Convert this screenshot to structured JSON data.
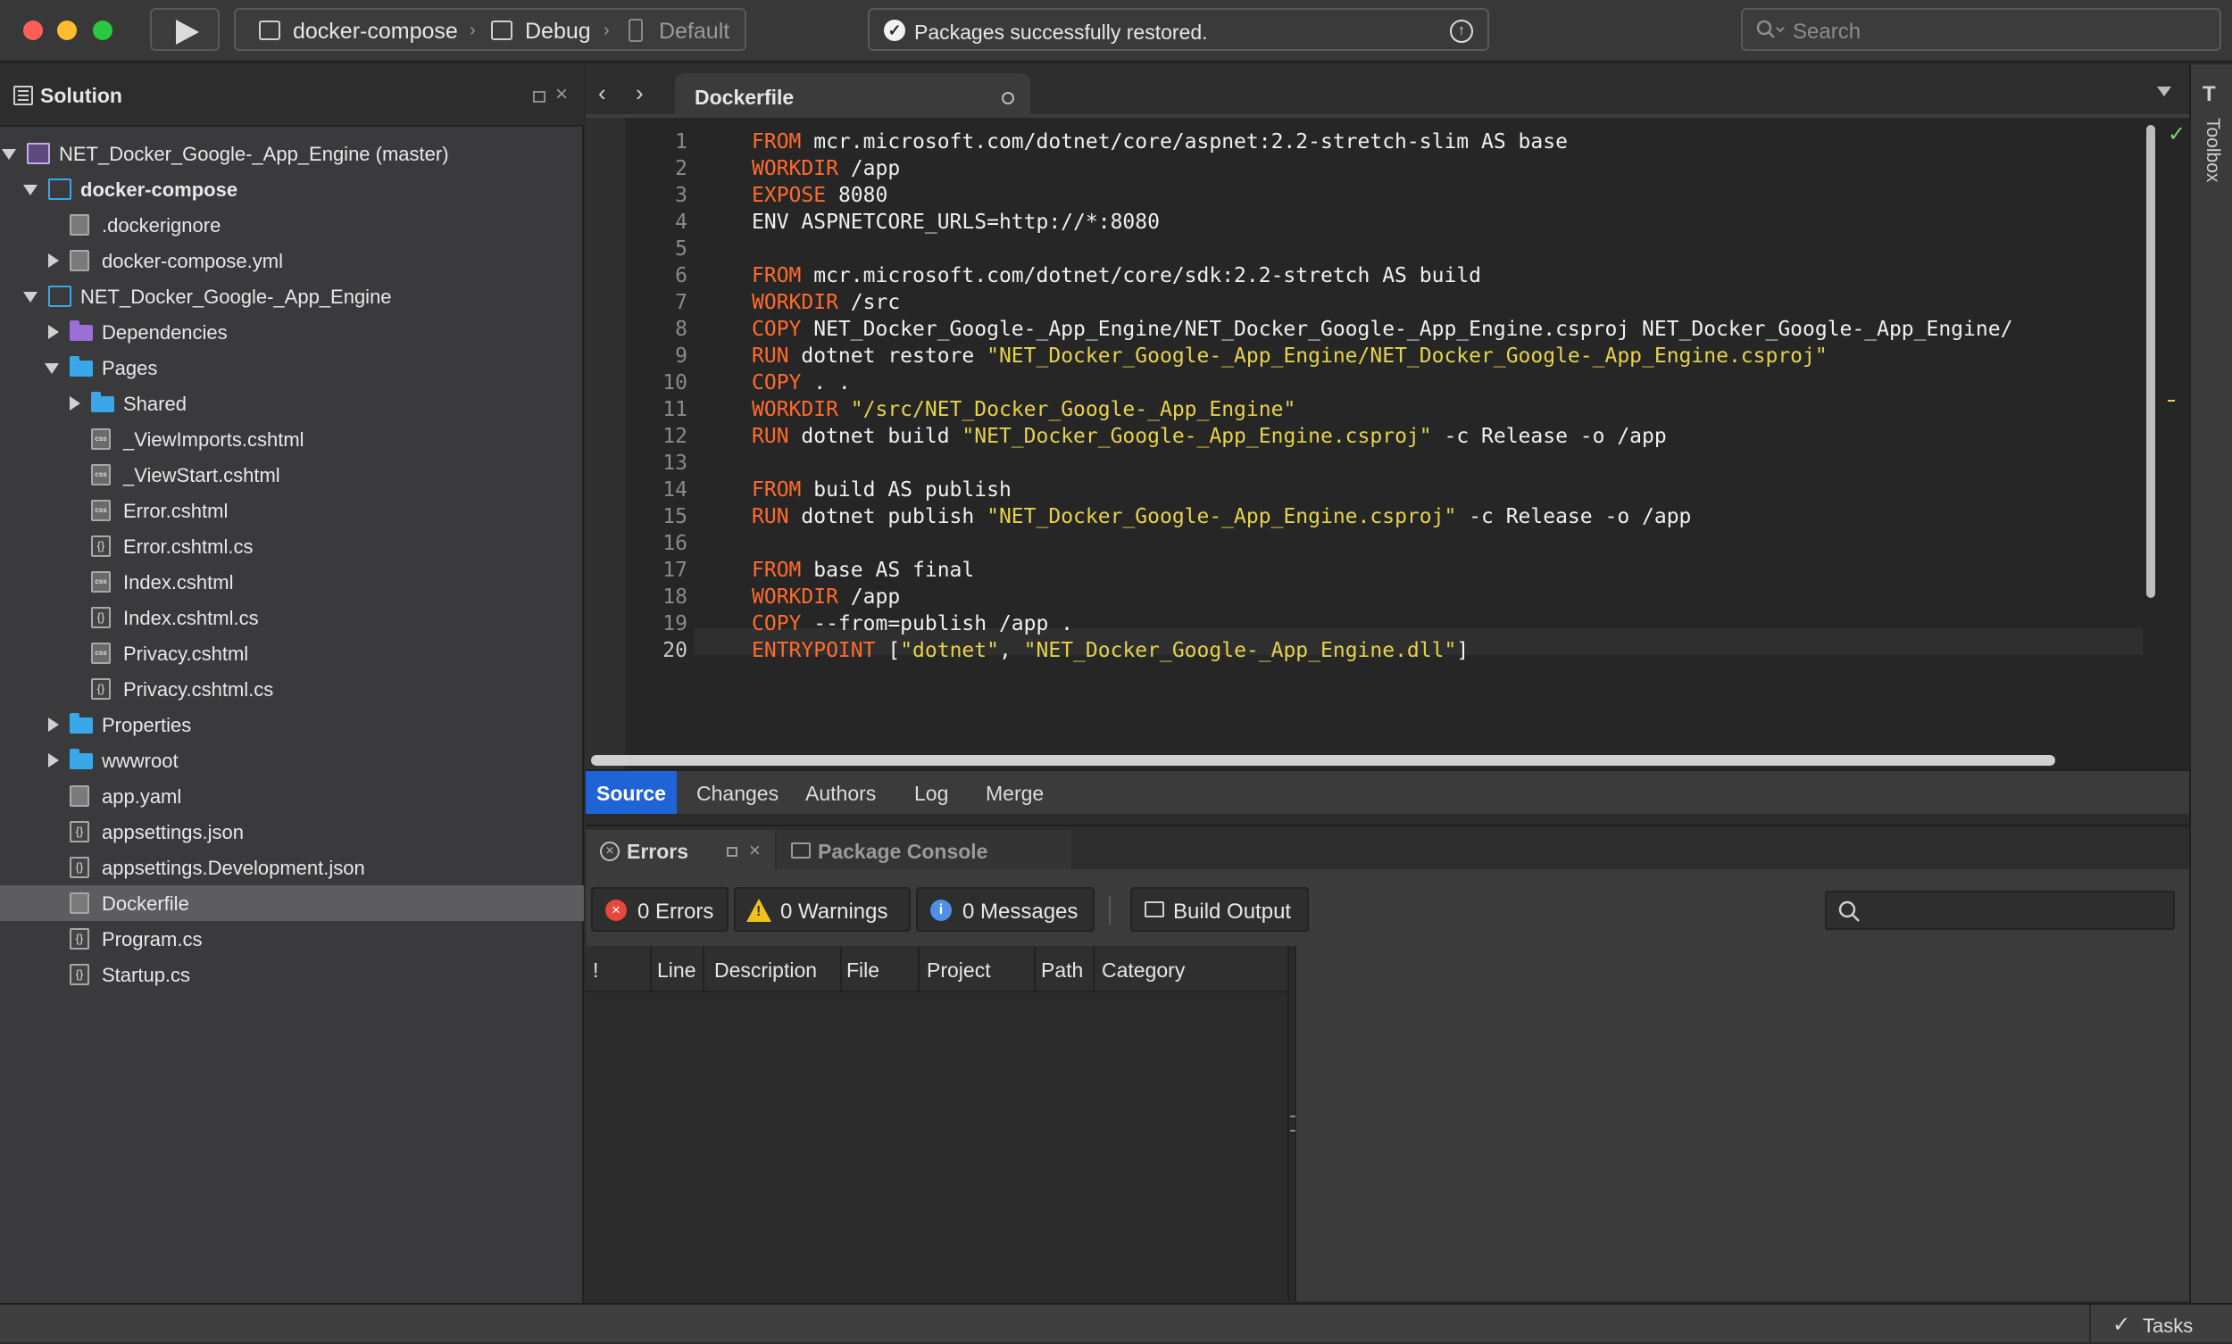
{
  "toolbar": {
    "config_project": "docker-compose",
    "config_mode": "Debug",
    "config_target": "Default",
    "status_text": "Packages successfully restored.",
    "search_placeholder": "Search"
  },
  "solution": {
    "title": "Solution",
    "items": [
      {
        "label": "NET_Docker_Google-_App_Engine (master)",
        "icon": "solution-icon"
      },
      {
        "label": "docker-compose",
        "icon": "project-icon"
      },
      {
        "label": ".dockerignore",
        "icon": "file-icon"
      },
      {
        "label": "docker-compose.yml",
        "icon": "file-icon"
      },
      {
        "label": "NET_Docker_Google-_App_Engine",
        "icon": "project-icon"
      },
      {
        "label": "Dependencies",
        "icon": "dependencies-folder-icon"
      },
      {
        "label": "Pages",
        "icon": "folder-icon"
      },
      {
        "label": "Shared",
        "icon": "folder-icon"
      },
      {
        "label": "_ViewImports.cshtml",
        "icon": "cshtml-file-icon"
      },
      {
        "label": "_ViewStart.cshtml",
        "icon": "cshtml-file-icon"
      },
      {
        "label": "Error.cshtml",
        "icon": "cshtml-file-icon"
      },
      {
        "label": "Error.cshtml.cs",
        "icon": "cs-file-icon"
      },
      {
        "label": "Index.cshtml",
        "icon": "cshtml-file-icon"
      },
      {
        "label": "Index.cshtml.cs",
        "icon": "cs-file-icon"
      },
      {
        "label": "Privacy.cshtml",
        "icon": "cshtml-file-icon"
      },
      {
        "label": "Privacy.cshtml.cs",
        "icon": "cs-file-icon"
      },
      {
        "label": "Properties",
        "icon": "folder-icon"
      },
      {
        "label": "wwwroot",
        "icon": "folder-icon"
      },
      {
        "label": "app.yaml",
        "icon": "file-icon"
      },
      {
        "label": "appsettings.json",
        "icon": "json-file-icon"
      },
      {
        "label": "appsettings.Development.json",
        "icon": "json-file-icon"
      },
      {
        "label": "Dockerfile",
        "icon": "file-icon"
      },
      {
        "label": "Program.cs",
        "icon": "cs-file-icon"
      },
      {
        "label": "Startup.cs",
        "icon": "cs-file-icon"
      }
    ]
  },
  "editor": {
    "tab_name": "Dockerfile",
    "lines": [
      [
        [
          "kw",
          "FROM"
        ],
        [
          "t",
          " mcr.microsoft.com/dotnet/core/aspnet:2.2-stretch-slim AS base"
        ]
      ],
      [
        [
          "kw",
          "WORKDIR"
        ],
        [
          "t",
          " /app"
        ]
      ],
      [
        [
          "kw",
          "EXPOSE"
        ],
        [
          "t",
          " 8080"
        ]
      ],
      [
        [
          "t",
          "ENV ASPNETCORE_URLS=http://*:8080"
        ]
      ],
      [],
      [
        [
          "kw",
          "FROM"
        ],
        [
          "t",
          " mcr.microsoft.com/dotnet/core/sdk:2.2-stretch AS build"
        ]
      ],
      [
        [
          "kw",
          "WORKDIR"
        ],
        [
          "t",
          " /src"
        ]
      ],
      [
        [
          "kw",
          "COPY"
        ],
        [
          "t",
          " NET_Docker_Google-_App_Engine/NET_Docker_Google-_App_Engine.csproj NET_Docker_Google-_App_Engine/"
        ]
      ],
      [
        [
          "kw",
          "RUN"
        ],
        [
          "t",
          " dotnet restore "
        ],
        [
          "str",
          "\"NET_Docker_Google-_App_Engine/NET_Docker_Google-_App_Engine.csproj\""
        ]
      ],
      [
        [
          "kw",
          "COPY"
        ],
        [
          "t",
          " . ."
        ]
      ],
      [
        [
          "kw",
          "WORKDIR"
        ],
        [
          "t",
          " "
        ],
        [
          "str",
          "\"/src/NET_Docker_Google-_App_Engine\""
        ]
      ],
      [
        [
          "kw",
          "RUN"
        ],
        [
          "t",
          " dotnet build "
        ],
        [
          "str",
          "\"NET_Docker_Google-_App_Engine.csproj\""
        ],
        [
          "t",
          " -c Release -o /app"
        ]
      ],
      [],
      [
        [
          "kw",
          "FROM"
        ],
        [
          "t",
          " build AS publish"
        ]
      ],
      [
        [
          "kw",
          "RUN"
        ],
        [
          "t",
          " dotnet publish "
        ],
        [
          "str",
          "\"NET_Docker_Google-_App_Engine.csproj\""
        ],
        [
          "t",
          " -c Release -o /app"
        ]
      ],
      [],
      [
        [
          "kw",
          "FROM"
        ],
        [
          "t",
          " base AS final"
        ]
      ],
      [
        [
          "kw",
          "WORKDIR"
        ],
        [
          "t",
          " /app"
        ]
      ],
      [
        [
          "kw",
          "COPY"
        ],
        [
          "t",
          " --from=publish /app ."
        ]
      ],
      [
        [
          "kw",
          "ENTRYPOINT"
        ],
        [
          "t",
          " ["
        ],
        [
          "str",
          "\"dotnet\""
        ],
        [
          "t",
          ", "
        ],
        [
          "str",
          "\"NET_Docker_Google-_App_Engine.dll\""
        ],
        [
          "t",
          "]"
        ]
      ]
    ]
  },
  "vc_tabs": [
    "Source",
    "Changes",
    "Authors",
    "Log",
    "Merge"
  ],
  "errors_pad": {
    "tab_errors": "Errors",
    "tab_console": "Package Console",
    "errors_btn": "0 Errors",
    "warnings_btn": "0 Warnings",
    "messages_btn": "0 Messages",
    "build_output_btn": "Build Output",
    "columns": [
      "!",
      "Line",
      "Description",
      "File",
      "Project",
      "Path",
      "Category"
    ]
  },
  "toolbox_label": "Toolbox",
  "statusbar": {
    "tasks": "Tasks"
  },
  "colors": {
    "keyword": "#ff6b2b",
    "string": "#e6d24a",
    "accent": "#1f63d6"
  }
}
